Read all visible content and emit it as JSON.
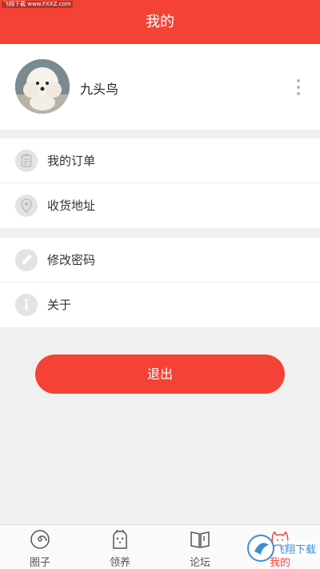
{
  "header": {
    "title": "我的",
    "watermark": "飞翔下载 www.FXXZ.com"
  },
  "profile": {
    "username": "九头鸟"
  },
  "menu_group_1": [
    {
      "label": "我的订单",
      "icon": "clipboard-icon"
    },
    {
      "label": "收货地址",
      "icon": "location-pin-icon"
    }
  ],
  "menu_group_2": [
    {
      "label": "修改密码",
      "icon": "pencil-icon"
    },
    {
      "label": "关于",
      "icon": "info-icon"
    }
  ],
  "logout_label": "退出",
  "tabs": [
    {
      "label": "圈子",
      "icon": "spiral-icon"
    },
    {
      "label": "领养",
      "icon": "pet-face-icon"
    },
    {
      "label": "论坛",
      "icon": "book-icon"
    },
    {
      "label": "我的",
      "icon": "cat-face-icon"
    }
  ],
  "colors": {
    "primary": "#f44336",
    "background": "#f0f0f0",
    "icon_gray": "#c8c8c8"
  },
  "bottom_watermark": "飞翔下载"
}
